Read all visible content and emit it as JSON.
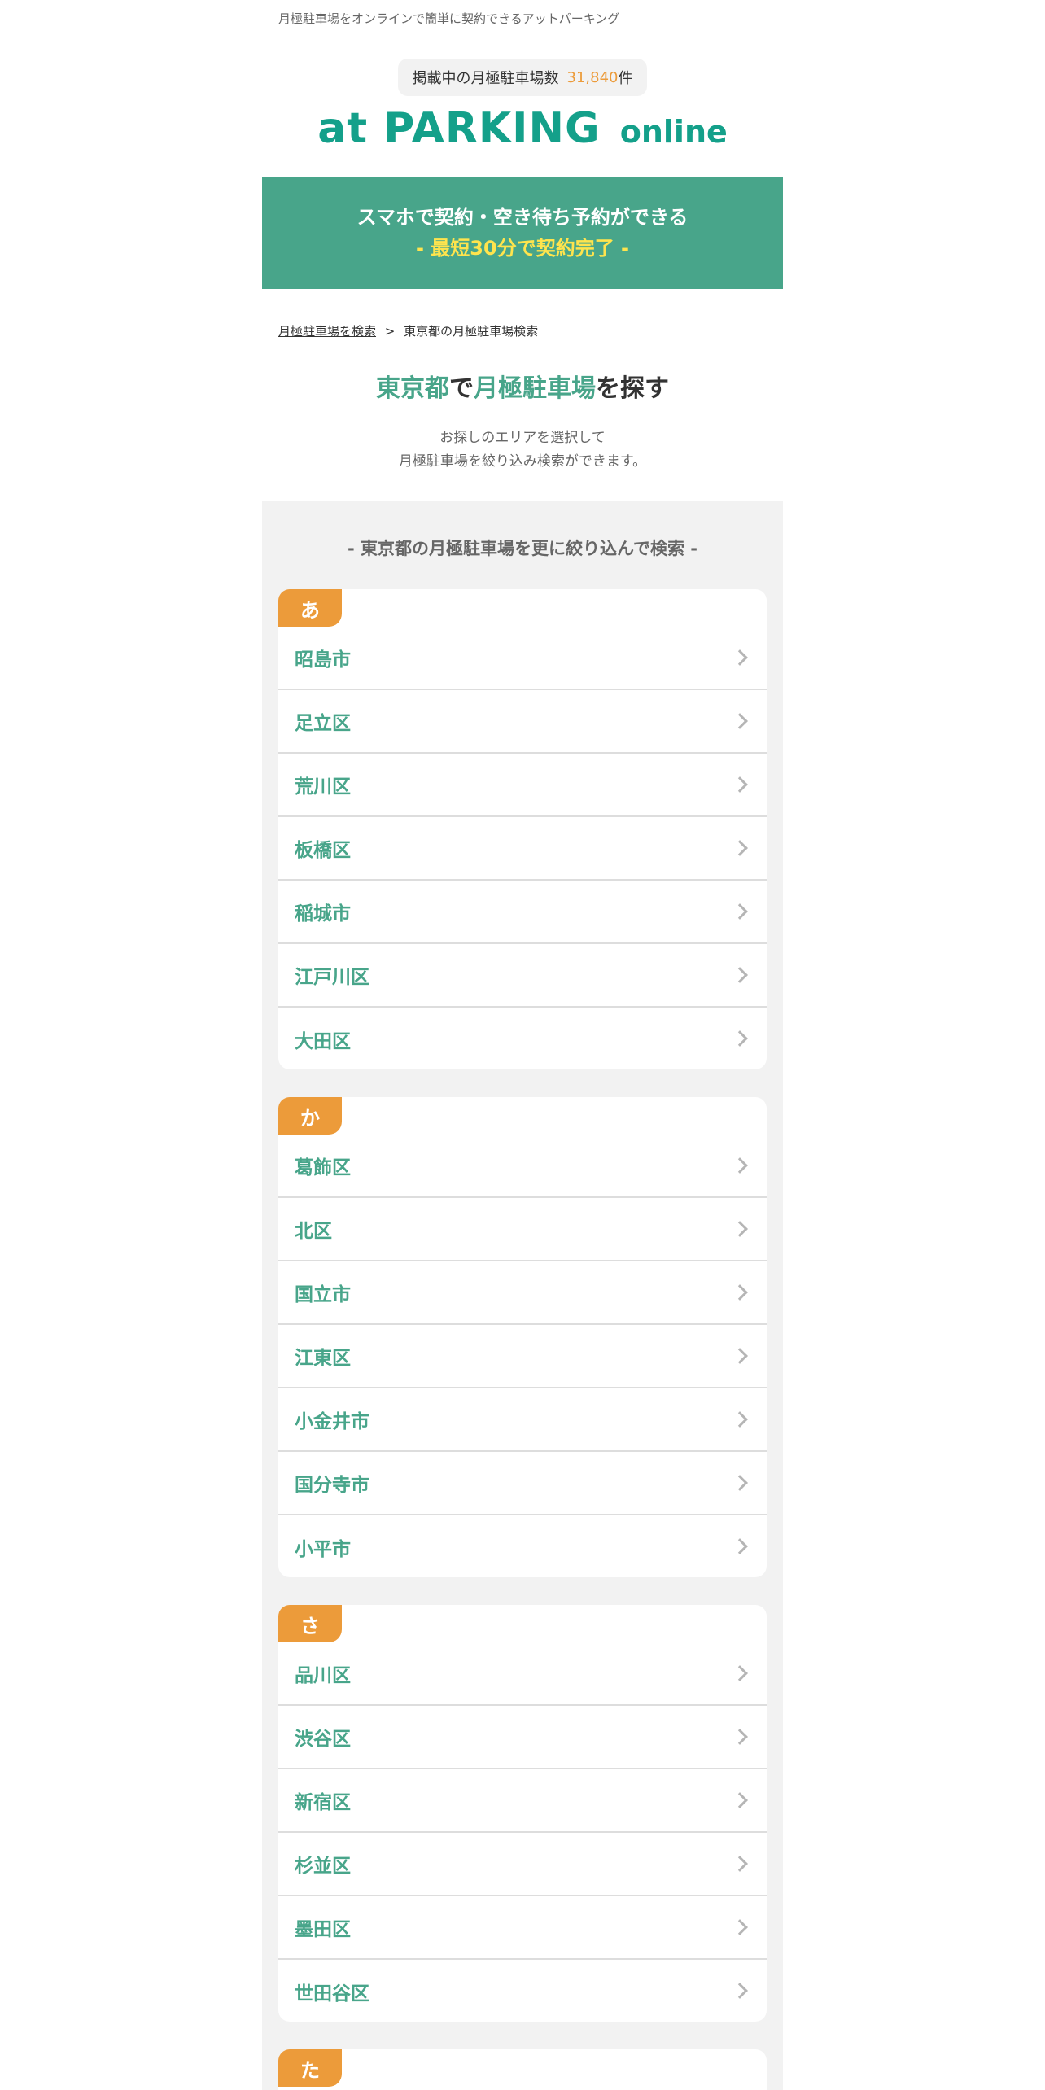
{
  "header": {
    "tagline": "月極駐車場をオンラインで簡単に契約できるアットパーキング",
    "count_label": "掲載中の月極駐車場数",
    "count_value": "31,840",
    "count_unit": "件",
    "logo_main": "at PARKING",
    "logo_sub": "online"
  },
  "banner": {
    "line1": "スマホで契約・空き待ち予約ができる",
    "line2": "- 最短30分で契約完了 -"
  },
  "breadcrumb": {
    "link": "月極駐車場を検索",
    "separator": ">",
    "current": "東京都の月極駐車場検索"
  },
  "heading": {
    "pref": "東京都",
    "de": "で",
    "target": "月極駐車場",
    "suffix": "を探す"
  },
  "lead": {
    "line1": "お探しのエリアを選択して",
    "line2": "月極駐車場を絞り込み検索ができます。"
  },
  "refine": {
    "title": "- 東京都の月極駐車場を更に絞り込んで検索 -",
    "groups": [
      {
        "kana": "あ",
        "items": [
          "昭島市",
          "足立区",
          "荒川区",
          "板橋区",
          "稲城市",
          "江戸川区",
          "大田区"
        ]
      },
      {
        "kana": "か",
        "items": [
          "葛飾区",
          "北区",
          "国立市",
          "江東区",
          "小金井市",
          "国分寺市",
          "小平市"
        ]
      },
      {
        "kana": "さ",
        "items": [
          "品川区",
          "渋谷区",
          "新宿区",
          "杉並区",
          "墨田区",
          "世田谷区"
        ]
      },
      {
        "kana": "た",
        "items": []
      }
    ]
  },
  "colors": {
    "brand_green": "#48a58a",
    "logo_green": "#14a08a",
    "accent_orange": "#ec9b3a",
    "banner_yellow": "#ffe44d"
  },
  "icons": {
    "list_item_arrow": "chevron-right-icon"
  }
}
